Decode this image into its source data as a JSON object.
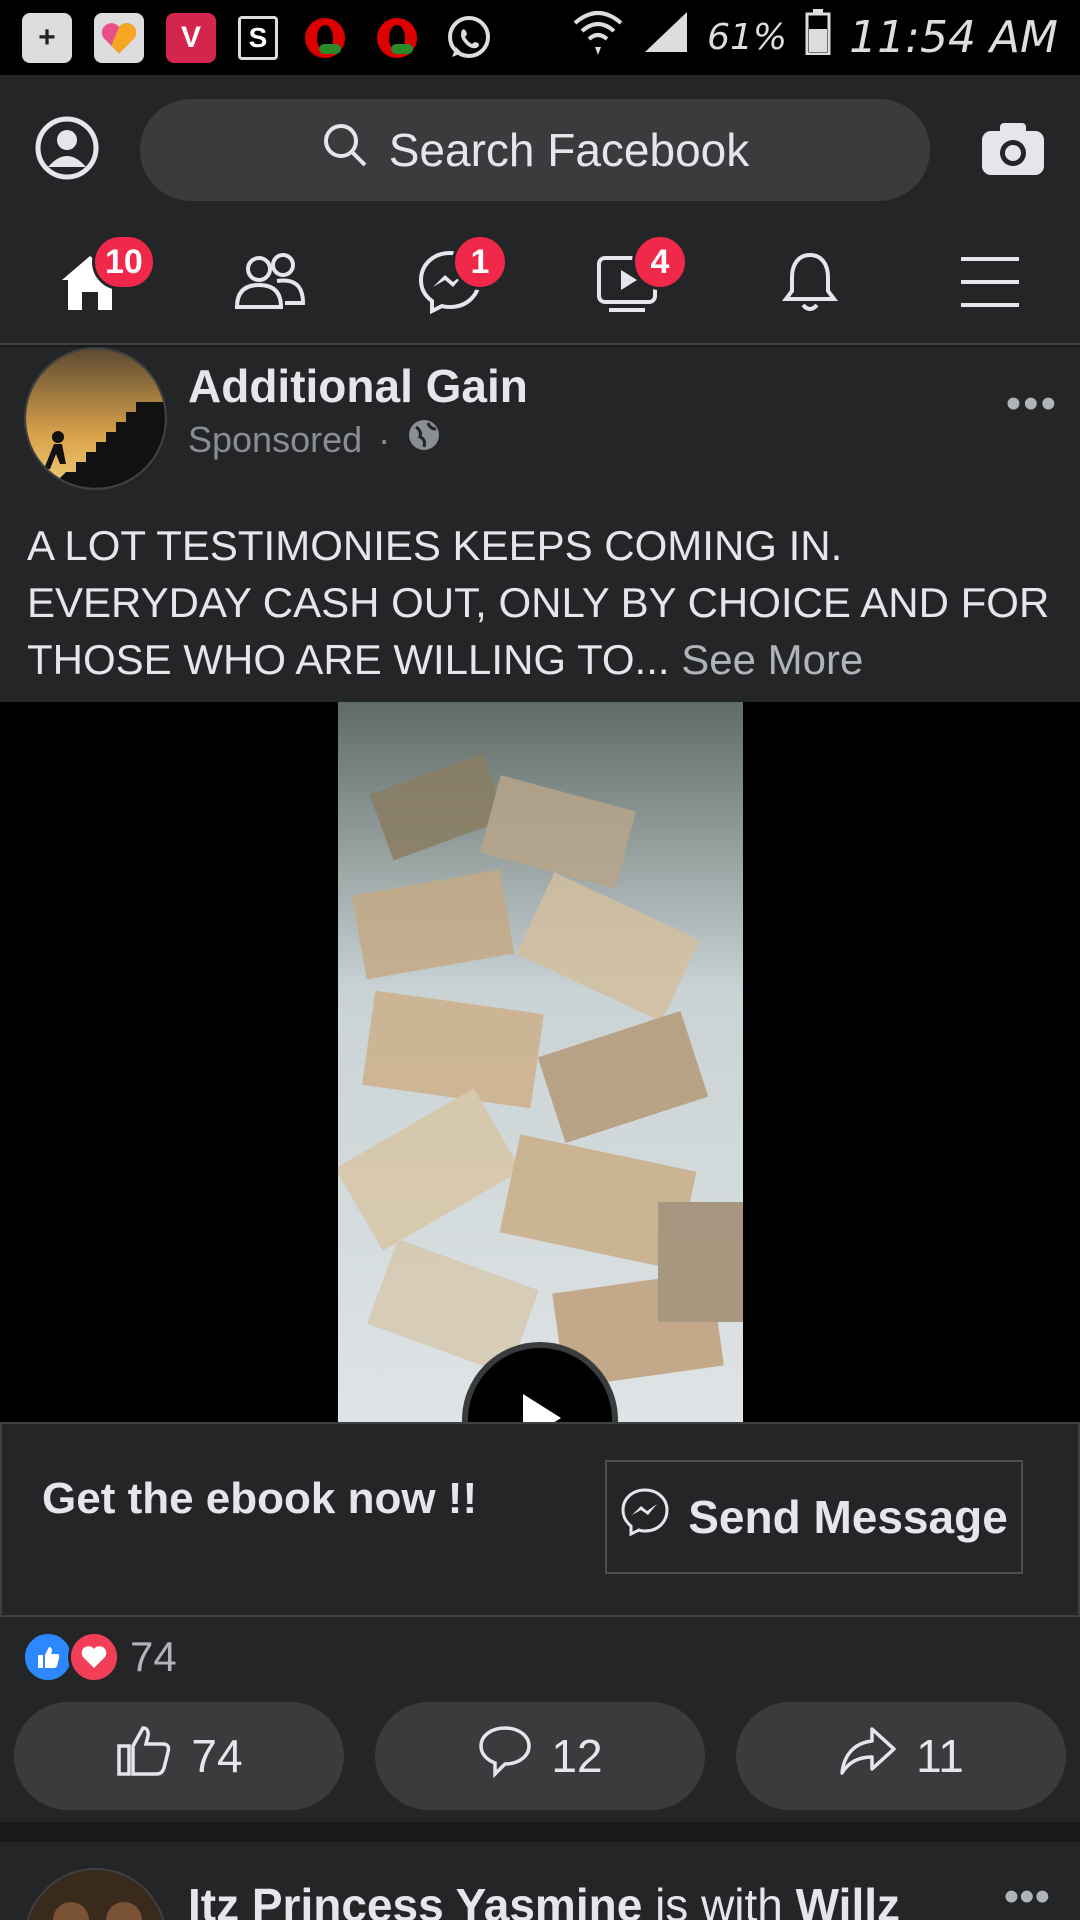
{
  "status_bar": {
    "battery": "61%",
    "time": "11:54 AM",
    "app_icons": [
      "plus-app-icon",
      "heart-app-icon",
      "v-app-icon",
      "s-app-icon",
      "opera-mini-icon",
      "opera-mini-icon",
      "whatsapp-icon"
    ]
  },
  "topbar": {
    "search_placeholder": "Search Facebook"
  },
  "nav": {
    "home_badge": "10",
    "messenger_badge": "1",
    "watch_badge": "4"
  },
  "post": {
    "author": "Additional Gain",
    "sponsored": "Sponsored",
    "dot": "·",
    "text": "A LOT TESTIMONIES KEEPS COMING IN. EVERYDAY CASH OUT, ONLY BY CHOICE AND FOR THOSE WHO ARE WILLING TO...",
    "see_more": "See More",
    "cta_title": "Get the ebook now !!",
    "cta_button": "Send Message",
    "reaction_count": "74",
    "actions": {
      "like_count": "74",
      "comment_count": "12",
      "share_count": "11"
    }
  },
  "next_post": {
    "name": "Itz Princess Yasmine",
    "with": " is with ",
    "tagged": "Willz"
  },
  "colors": {
    "background": "#18191a",
    "card": "#242526",
    "button": "#3a3b3c",
    "badge": "#f02849",
    "like_blue": "#2d88ff",
    "love_red": "#f33e58"
  }
}
